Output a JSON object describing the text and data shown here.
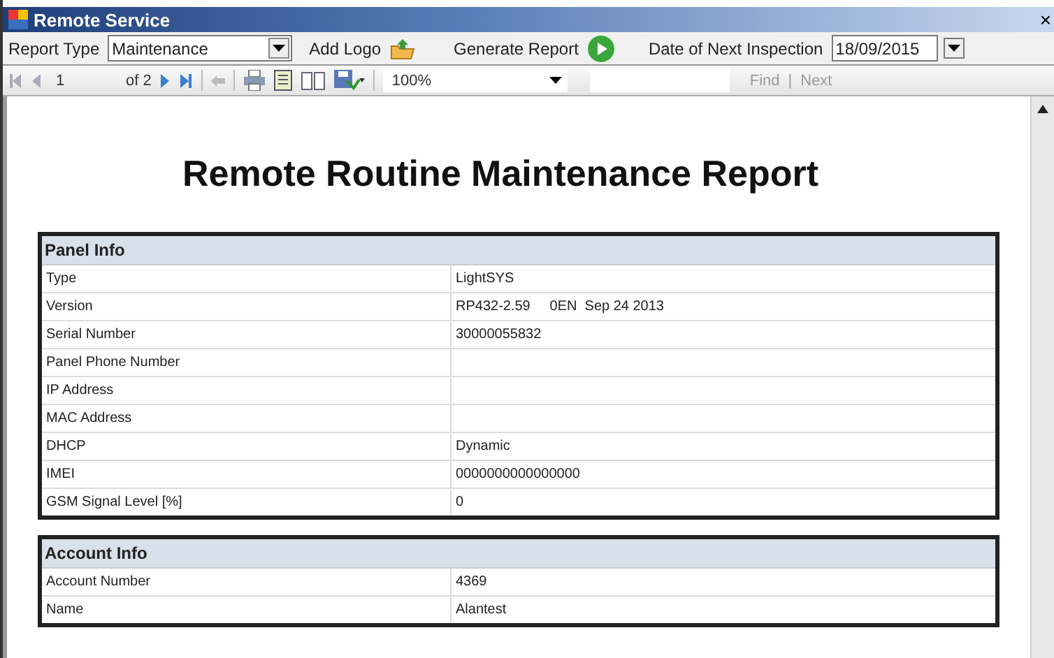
{
  "window": {
    "title": "Remote Service",
    "close": "×"
  },
  "toolbar": {
    "report_type_label": "Report Type",
    "report_type": "Maintenance",
    "add_logo": "Add Logo",
    "generate": "Generate Report",
    "date_label": "Date of Next Inspection",
    "date": "18/09/2015"
  },
  "viewer": {
    "page": "1",
    "page_count": "of 2",
    "zoom": "100%",
    "find": "Find",
    "separator": "|",
    "next": "Next"
  },
  "report": {
    "title": "Remote Routine Maintenance Report",
    "sections": [
      {
        "title": "Panel Info",
        "rows": [
          {
            "label": "Type",
            "value": "LightSYS"
          },
          {
            "label": "Version",
            "value": "RP432-2.59     0EN  Sep 24 2013"
          },
          {
            "label": "Serial Number",
            "value": "30000055832"
          },
          {
            "label": "Panel Phone Number",
            "value": ""
          },
          {
            "label": "IP Address",
            "value": ""
          },
          {
            "label": "MAC Address",
            "value": ""
          },
          {
            "label": "DHCP",
            "value": "Dynamic"
          },
          {
            "label": "IMEI",
            "value": "0000000000000000"
          },
          {
            "label": "GSM Signal Level [%]",
            "value": "0"
          }
        ]
      },
      {
        "title": "Account Info",
        "rows": [
          {
            "label": "Account Number",
            "value": "4369"
          },
          {
            "label": "Name",
            "value": "Alantest"
          }
        ]
      }
    ]
  }
}
